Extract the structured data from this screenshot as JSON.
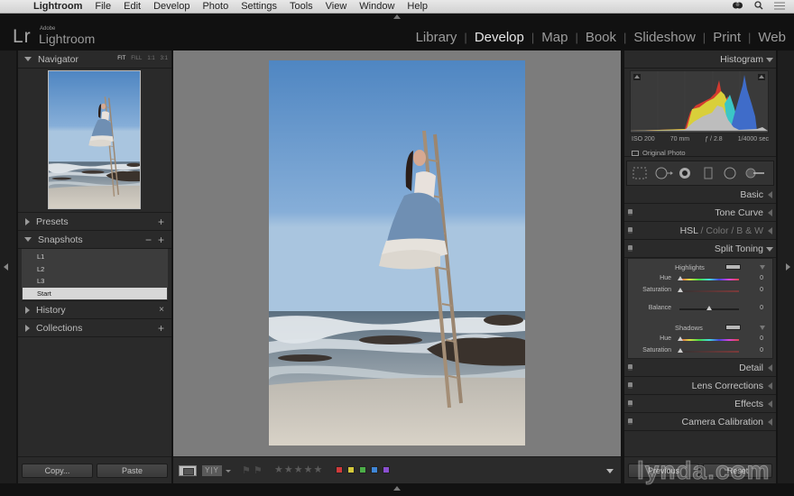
{
  "menubar": {
    "apple": "",
    "items": [
      "Lightroom",
      "File",
      "Edit",
      "Develop",
      "Photo",
      "Settings",
      "Tools",
      "View",
      "Window",
      "Help"
    ],
    "right_icons": [
      "creative-cloud-icon",
      "search-icon",
      "list-icon"
    ]
  },
  "header": {
    "logo_mark": "Lr",
    "logo_adobe": "Adobe",
    "logo_name": "Lightroom",
    "modules": [
      {
        "label": "Library",
        "active": false
      },
      {
        "label": "Develop",
        "active": true
      },
      {
        "label": "Map",
        "active": false
      },
      {
        "label": "Book",
        "active": false
      },
      {
        "label": "Slideshow",
        "active": false
      },
      {
        "label": "Print",
        "active": false
      },
      {
        "label": "Web",
        "active": false
      }
    ]
  },
  "left_panel": {
    "navigator": {
      "title": "Navigator",
      "zoom_options": [
        "FIT",
        "FILL",
        "1:1",
        "3:1"
      ],
      "active_zoom": "FIT"
    },
    "presets": {
      "title": "Presets",
      "action": "+"
    },
    "snapshots": {
      "title": "Snapshots",
      "action_minus": "−",
      "action_plus": "+",
      "items": [
        "L1",
        "L2",
        "L3",
        "Start"
      ],
      "selected": "Start"
    },
    "history": {
      "title": "History",
      "action": "×"
    },
    "collections": {
      "title": "Collections",
      "action": "+"
    },
    "copy_button": "Copy...",
    "paste_button": "Paste"
  },
  "toolbar": {
    "view_mode_icon": "loupe-view-icon",
    "compare_label": "Y|Y",
    "flags": "⚑⚑",
    "stars": "★★★★★",
    "color_labels": [
      "#d03a3a",
      "#d4c83a",
      "#4cae48",
      "#3f86d6",
      "#8a4fd0"
    ]
  },
  "right_panel": {
    "histogram": {
      "title": "Histogram",
      "iso": "ISO 200",
      "focal_length": "70 mm",
      "aperture": "ƒ / 2.8",
      "shutter": "1/4000 sec",
      "original_photo_label": "Original Photo"
    },
    "sections": {
      "basic": "Basic",
      "tone_curve": "Tone Curve",
      "hsl": "HSL",
      "color": "Color",
      "bw": "B & W",
      "split_toning": "Split Toning",
      "detail": "Detail",
      "lens_corrections": "Lens Corrections",
      "effects": "Effects",
      "camera_calibration": "Camera Calibration"
    },
    "split_toning": {
      "highlights_label": "Highlights",
      "highlights_hue_label": "Hue",
      "highlights_hue": "0",
      "highlights_sat_label": "Saturation",
      "highlights_sat": "0",
      "balance_label": "Balance",
      "balance": "0",
      "shadows_label": "Shadows",
      "shadows_hue_label": "Hue",
      "shadows_hue": "0",
      "shadows_sat_label": "Saturation",
      "shadows_sat": "0"
    },
    "previous_button": "Previous",
    "reset_button": "Reset"
  },
  "watermark": "lynda.com"
}
